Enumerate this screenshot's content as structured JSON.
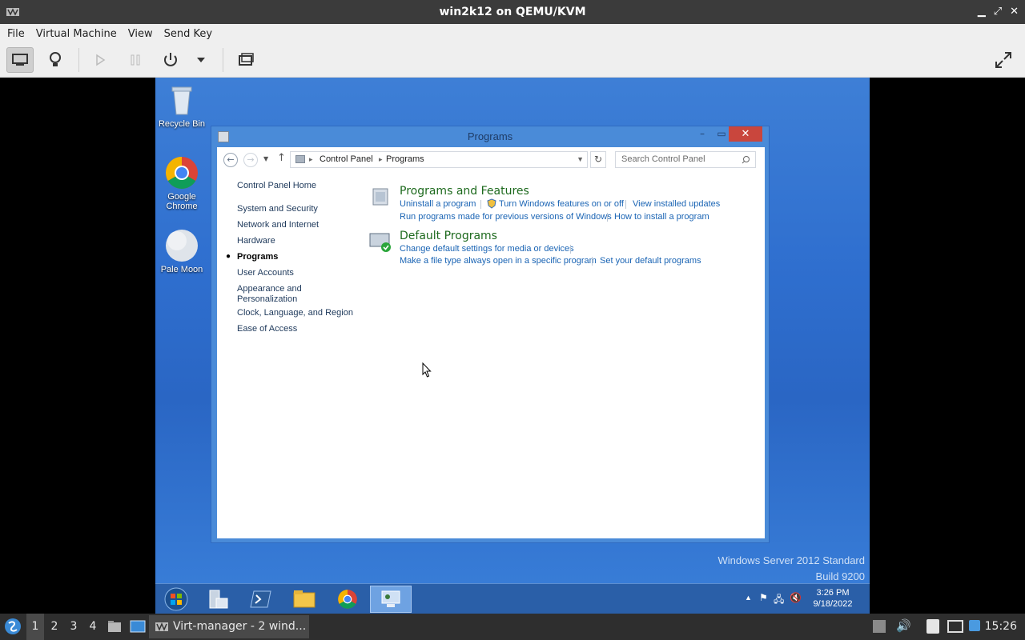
{
  "vm": {
    "window_title": "win2k12 on QEMU/KVM",
    "menu": [
      "File",
      "Virtual Machine",
      "View",
      "Send Key"
    ]
  },
  "desktop": {
    "icons": [
      {
        "label": "Recycle Bin",
        "icon": "recycle-bin-icon"
      },
      {
        "label": "Google Chrome",
        "icon": "chrome-icon"
      },
      {
        "label": "Pale Moon",
        "icon": "pale-moon-icon"
      }
    ],
    "watermark_line1": "Windows Server 2012 Standard",
    "watermark_line2": "Build 9200"
  },
  "explorer": {
    "title": "Programs",
    "breadcrumb": [
      "Control Panel",
      "Programs"
    ],
    "search_placeholder": "Search Control Panel",
    "nav": {
      "home": "Control Panel Home",
      "items": [
        "System and Security",
        "Network and Internet",
        "Hardware",
        "Programs",
        "User Accounts",
        "Appearance and Personalization",
        "Clock, Language, and Region",
        "Ease of Access"
      ],
      "selected": "Programs"
    },
    "categories": [
      {
        "title": "Programs and Features",
        "links": [
          "Uninstall a program",
          "Turn Windows features on or off",
          "View installed updates",
          "Run programs made for previous versions of Windows",
          "How to install a program"
        ]
      },
      {
        "title": "Default Programs",
        "links": [
          "Change default settings for media or devices",
          "Make a file type always open in a specific program",
          "Set your default programs"
        ]
      }
    ]
  },
  "guest_taskbar": {
    "time": "3:26 PM",
    "date": "9/18/2022"
  },
  "host_panel": {
    "workspaces": [
      "1",
      "2",
      "3",
      "4"
    ],
    "current_workspace": "1",
    "task_label": "Virt-manager - 2 wind...",
    "clock": "15:26"
  }
}
